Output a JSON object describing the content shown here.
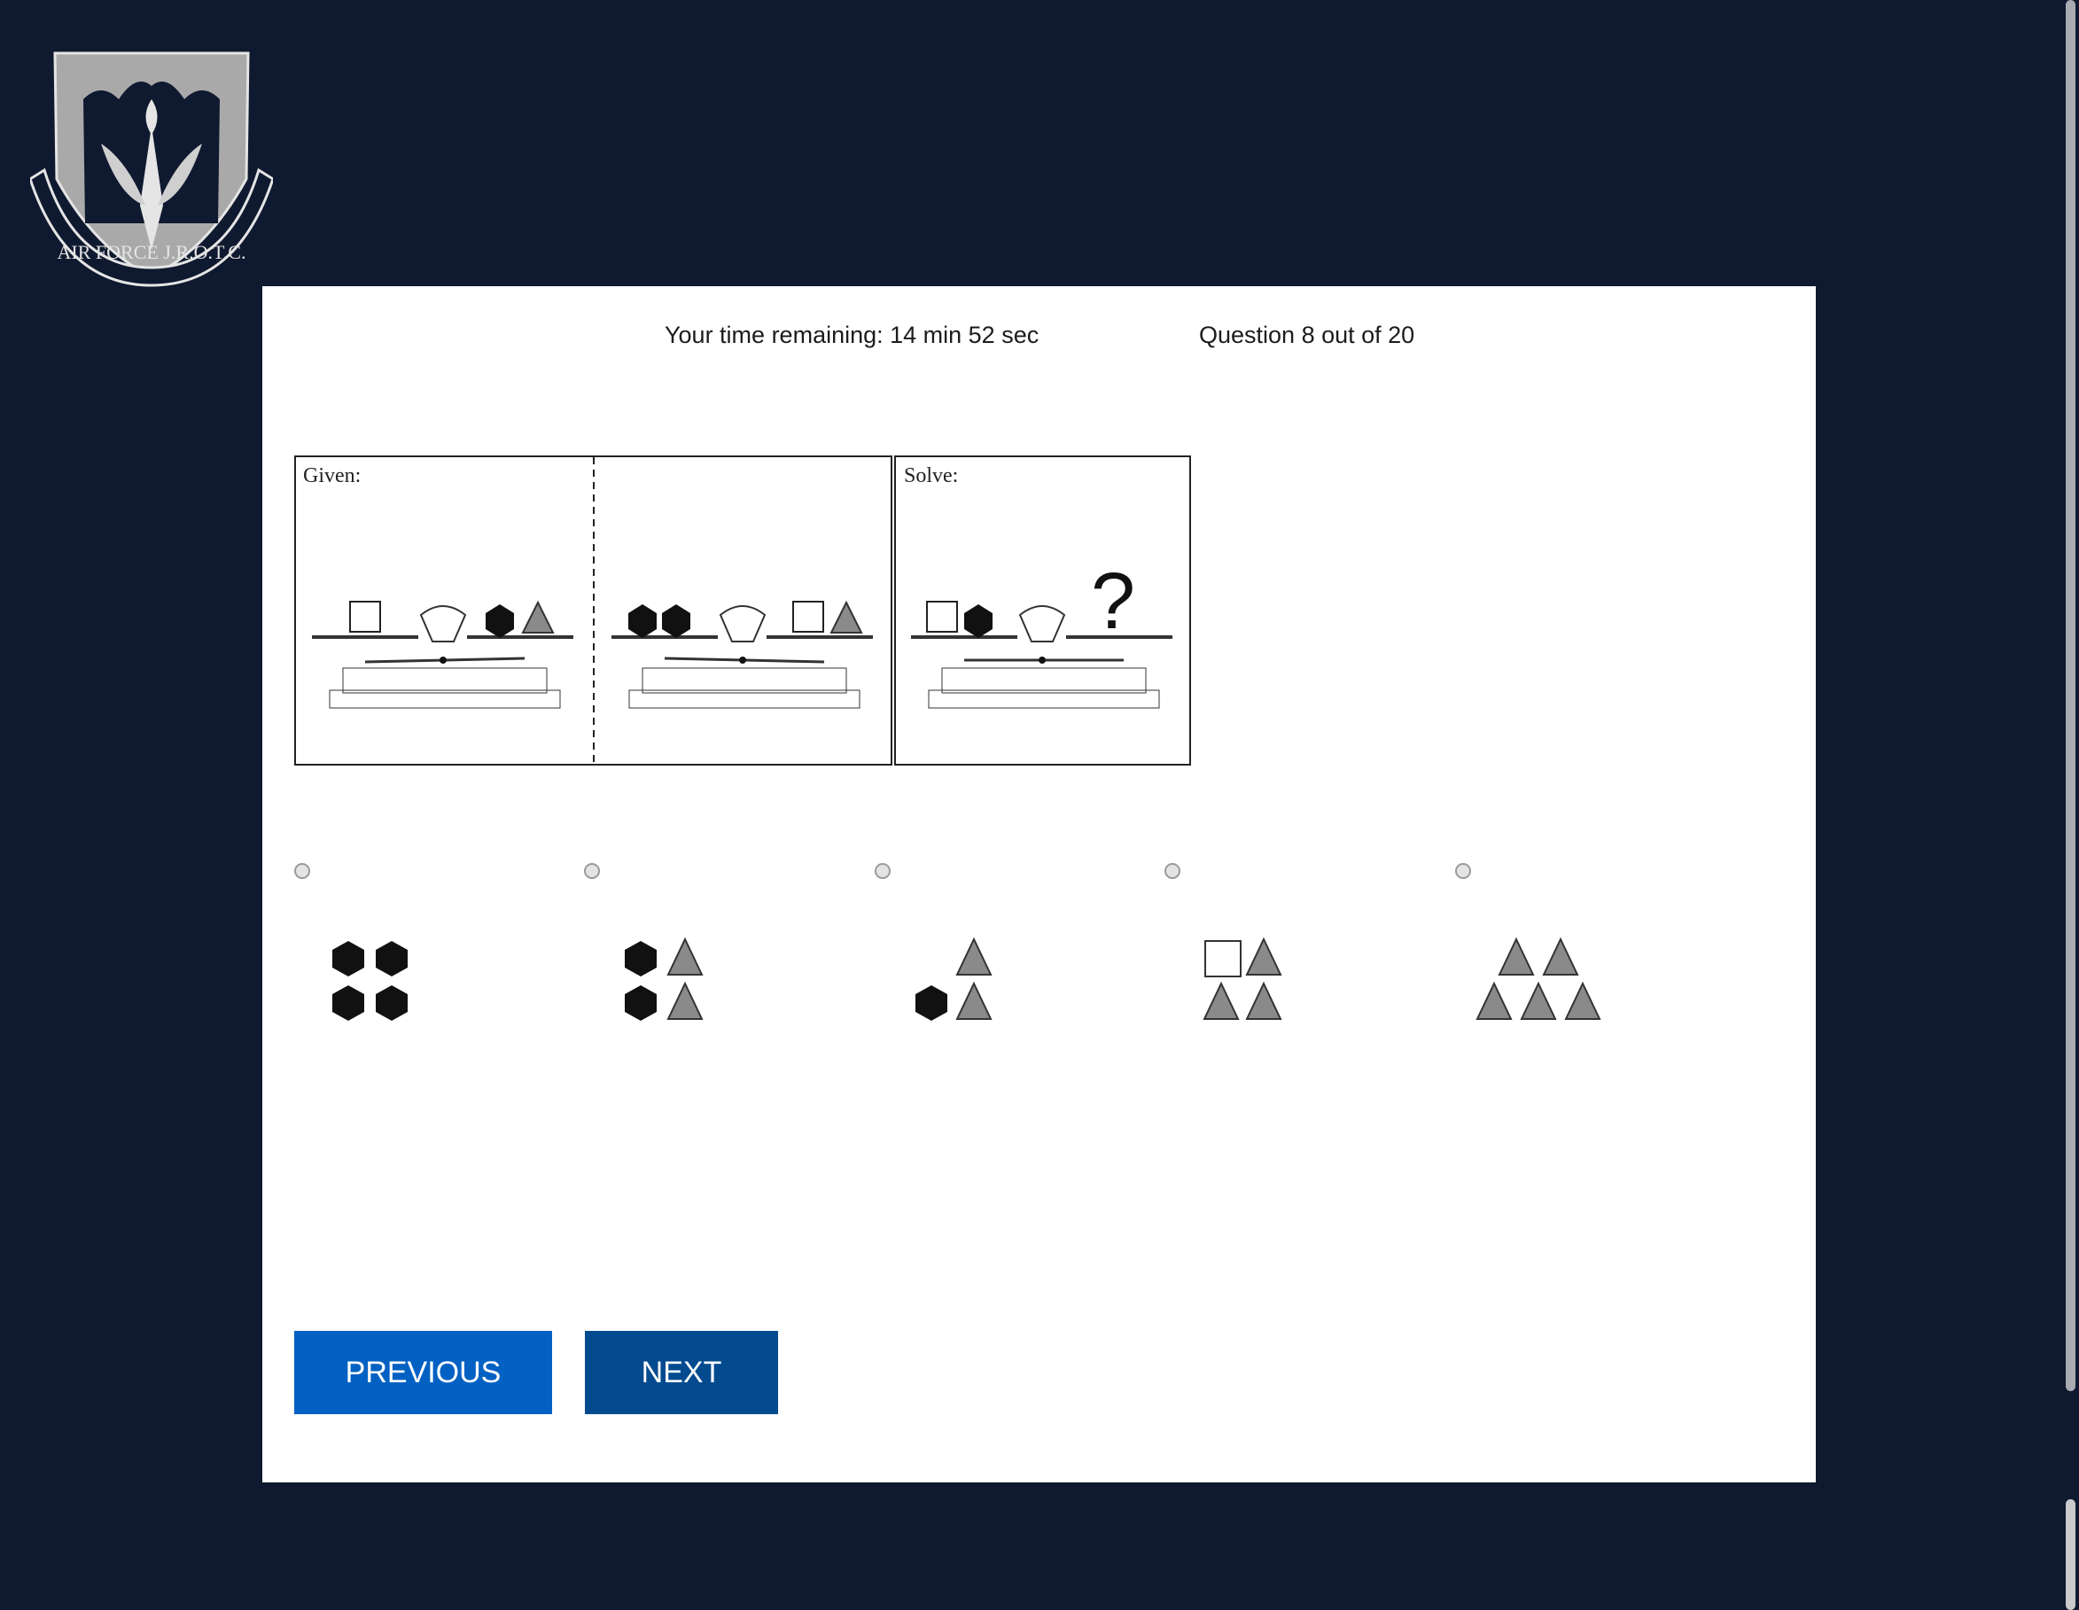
{
  "logo": {
    "text": "AIR FORCE J.R.O.T.C.",
    "name": "afjrotc-emblem"
  },
  "status": {
    "time_remaining": "Your time remaining: 14 min 52 sec",
    "question_counter": "Question 8 out of 20"
  },
  "problem": {
    "given_label": "Given:",
    "solve_label": "Solve:",
    "question_mark": "?"
  },
  "options": [
    {
      "id": "a",
      "shapes": "4 hexagons"
    },
    {
      "id": "b",
      "shapes": "2 hexagons, 2 triangles"
    },
    {
      "id": "c",
      "shapes": "1 hexagon, 2 triangles"
    },
    {
      "id": "d",
      "shapes": "1 square, 3 triangles"
    },
    {
      "id": "e",
      "shapes": "5 triangles"
    }
  ],
  "buttons": {
    "previous": "PREVIOUS",
    "next": "NEXT"
  },
  "colors": {
    "background": "#0f192f",
    "panel": "#ffffff",
    "previous": "#0261c2",
    "next": "#044a8f"
  }
}
